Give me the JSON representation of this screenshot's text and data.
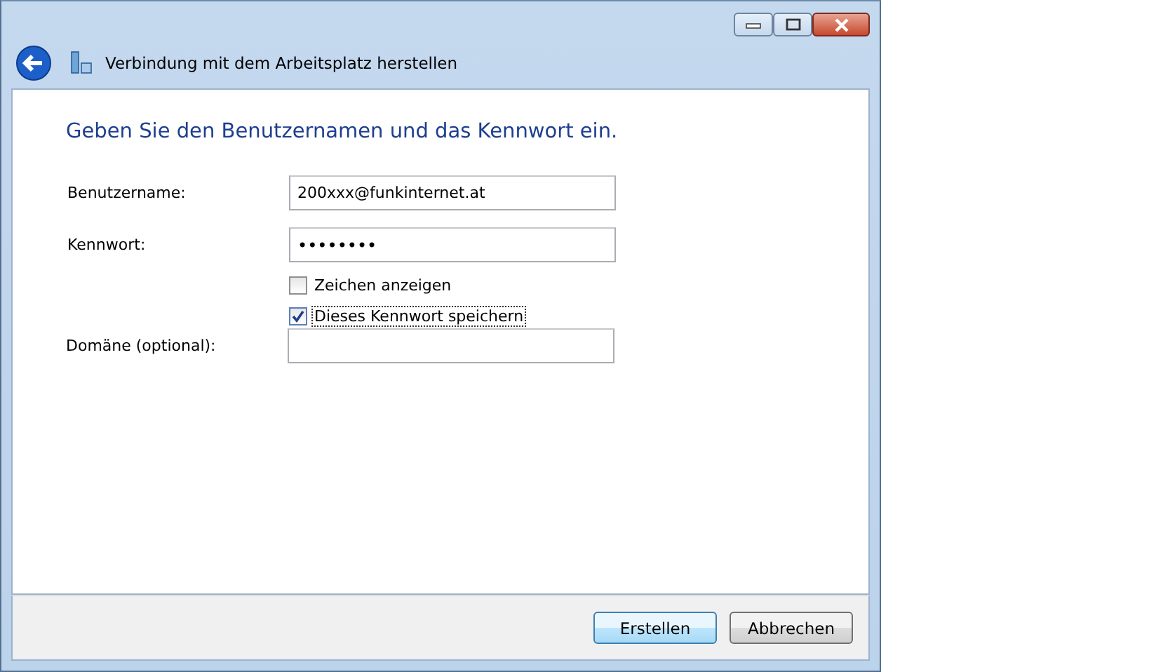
{
  "window": {
    "title": "Verbindung mit dem Arbeitsplatz herstellen"
  },
  "heading": "Geben Sie den Benutzernamen und das Kennwort ein.",
  "username": {
    "label": "Benutzername:",
    "value": "200xxx@funkinternet.at"
  },
  "password": {
    "label": "Kennwort:",
    "value": "••••••••"
  },
  "options": [
    {
      "label": "Zeichen anzeigen",
      "checked": false,
      "focused": false
    },
    {
      "label": "Dieses Kennwort speichern",
      "checked": true,
      "focused": true
    }
  ],
  "domain": {
    "label": "Domäne (optional):"
  },
  "buttons": [
    {
      "label": "Erstellen",
      "default": true
    },
    {
      "label": "Abbrechen",
      "default": false
    }
  ]
}
